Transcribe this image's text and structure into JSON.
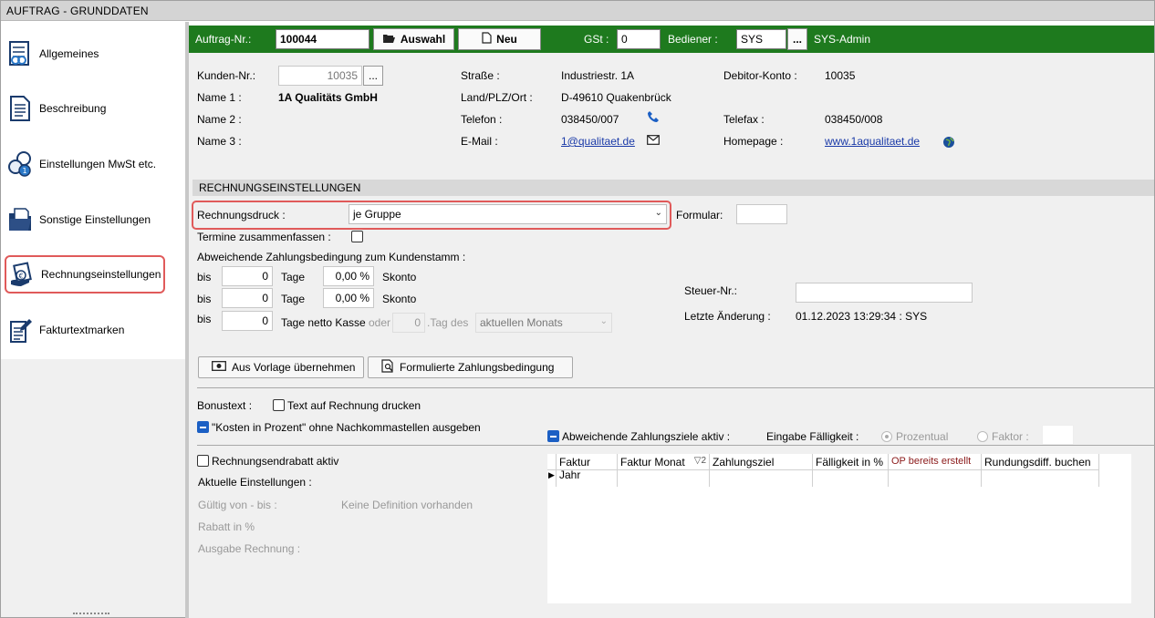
{
  "window": {
    "title": "AUFTRAG - GRUNDDATEN"
  },
  "sidebar": {
    "items": [
      {
        "label": "Allgemeines",
        "icon": "link-document-icon"
      },
      {
        "label": "Beschreibung",
        "icon": "text-document-icon"
      },
      {
        "label": "Einstellungen MwSt etc.",
        "icon": "coins-gear-icon"
      },
      {
        "label": "Sonstige Einstellungen",
        "icon": "folder-document-icon"
      },
      {
        "label": "Rechnungseinstellungen",
        "icon": "invoice-hand-icon",
        "active": true
      },
      {
        "label": "Fakturtextmarken",
        "icon": "edit-document-icon"
      }
    ]
  },
  "header": {
    "order_label": "Auftrag-Nr.:",
    "order_value": "100044",
    "select_button": "Auswahl",
    "new_button": "Neu",
    "gst_label": "GSt :",
    "gst_value": "0",
    "operator_label": "Bediener :",
    "operator_value": "SYS",
    "operator_button": "...",
    "operator_name": "SYS-Admin"
  },
  "customer": {
    "number_label": "Kunden-Nr.:",
    "number_value": "10035",
    "number_button": "...",
    "name1_label": "Name 1 :",
    "name1_value": "1A Qualitäts GmbH",
    "name2_label": "Name 2 :",
    "name3_label": "Name 3 :",
    "street_label": "Straße :",
    "street_value": "Industriestr. 1A",
    "city_label": "Land/PLZ/Ort :",
    "city_value": "D-49610 Quakenbrück",
    "phone_label": "Telefon :",
    "phone_value": "038450/007",
    "email_label": "E-Mail :",
    "email_value": "1@qualitaet.de",
    "debtor_label": "Debitor-Konto :",
    "debtor_value": "10035",
    "fax_label": "Telefax :",
    "fax_value": "038450/008",
    "homepage_label": "Homepage :",
    "homepage_value": "www.1aqualitaet.de"
  },
  "invoice": {
    "section_title": "RECHNUNGSEINSTELLUNGEN",
    "print_label": "Rechnungsdruck :",
    "print_value": "je Gruppe",
    "form_label": "Formular:",
    "merge_label": "Termine zusammenfassen :",
    "terms_title": "Abweichende Zahlungsbedingung zum Kundenstamm :",
    "rows": [
      {
        "bis": "bis",
        "days": "0",
        "days_label": "Tage",
        "pct": "0,00 %",
        "pct_label": "Skonto"
      },
      {
        "bis": "bis",
        "days": "0",
        "days_label": "Tage",
        "pct": "0,00 %",
        "pct_label": "Skonto"
      }
    ],
    "net_row": {
      "bis": "bis",
      "days": "0",
      "days_label": "Tage netto Kasse",
      "or_label": "oder",
      "day_value": "0",
      "day_of_label": ".Tag des",
      "month_value": "aktuellen Monats"
    },
    "tax_label": "Steuer-Nr.:",
    "changed_label": "Letzte Änderung :",
    "changed_value": "01.12.2023 13:29:34 : SYS",
    "template_button": "Aus Vorlage übernehmen",
    "formulated_button": "Formulierte Zahlungsbedingung",
    "bonus_label": "Bonustext :",
    "bonus_check": "Text auf Rechnung drucken",
    "percent_check": "\"Kosten in Prozent\" ohne Nachkommastellen ausgeben",
    "deviating_check": "Abweichende Zahlungsziele aktiv :",
    "due_label": "Eingabe Fälligkeit :",
    "due_percent": "Prozentual",
    "due_factor": "Faktor :",
    "discount_check": "Rechnungsendrabatt aktiv",
    "current_label": "Aktuelle Einstellungen :",
    "valid_label": "Gültig von - bis :",
    "no_definition": "Keine Definition vorhanden",
    "rebate_label": "Rabatt in %",
    "output_label": "Ausgabe Rechnung :"
  },
  "grid": {
    "columns": [
      "Faktur Jahr",
      "Faktur Monat",
      "Zahlungsziel",
      "Fälligkeit in %",
      "OP bereits erstellt",
      "Rundungsdiff. buchen"
    ],
    "sort_marker": "2"
  }
}
